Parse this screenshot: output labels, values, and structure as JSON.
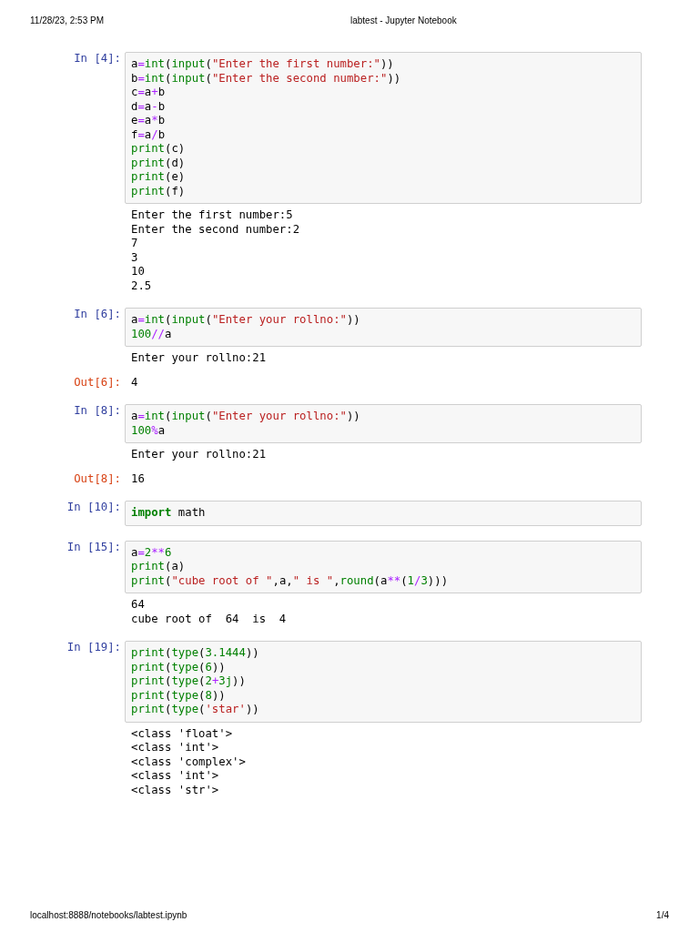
{
  "header": {
    "timestamp": "11/28/23, 2:53 PM",
    "title": "labtest - Jupyter Notebook"
  },
  "cells": [
    {
      "kind": "input",
      "prompt": "In [4]:",
      "lines": [
        [
          {
            "text": "a",
            "kind": "plain"
          },
          {
            "text": "=",
            "kind": "operator"
          },
          {
            "text": "int",
            "kind": "builtin"
          },
          {
            "text": "(",
            "kind": "plain"
          },
          {
            "text": "input",
            "kind": "builtin"
          },
          {
            "text": "(",
            "kind": "plain"
          },
          {
            "text": "\"Enter the first number:\"",
            "kind": "string"
          },
          {
            "text": "))",
            "kind": "plain"
          }
        ],
        [
          {
            "text": "b",
            "kind": "plain"
          },
          {
            "text": "=",
            "kind": "operator"
          },
          {
            "text": "int",
            "kind": "builtin"
          },
          {
            "text": "(",
            "kind": "plain"
          },
          {
            "text": "input",
            "kind": "builtin"
          },
          {
            "text": "(",
            "kind": "plain"
          },
          {
            "text": "\"Enter the second number:\"",
            "kind": "string"
          },
          {
            "text": "))",
            "kind": "plain"
          }
        ],
        [
          {
            "text": "c",
            "kind": "plain"
          },
          {
            "text": "=",
            "kind": "operator"
          },
          {
            "text": "a",
            "kind": "plain"
          },
          {
            "text": "+",
            "kind": "operator"
          },
          {
            "text": "b",
            "kind": "plain"
          }
        ],
        [
          {
            "text": "d",
            "kind": "plain"
          },
          {
            "text": "=",
            "kind": "operator"
          },
          {
            "text": "a",
            "kind": "plain"
          },
          {
            "text": "-",
            "kind": "operator"
          },
          {
            "text": "b",
            "kind": "plain"
          }
        ],
        [
          {
            "text": "e",
            "kind": "plain"
          },
          {
            "text": "=",
            "kind": "operator"
          },
          {
            "text": "a",
            "kind": "plain"
          },
          {
            "text": "*",
            "kind": "operator"
          },
          {
            "text": "b",
            "kind": "plain"
          }
        ],
        [
          {
            "text": "f",
            "kind": "plain"
          },
          {
            "text": "=",
            "kind": "operator"
          },
          {
            "text": "a",
            "kind": "plain"
          },
          {
            "text": "/",
            "kind": "operator"
          },
          {
            "text": "b",
            "kind": "plain"
          }
        ],
        [
          {
            "text": "print",
            "kind": "builtin"
          },
          {
            "text": "(c)",
            "kind": "plain"
          }
        ],
        [
          {
            "text": "print",
            "kind": "builtin"
          },
          {
            "text": "(d)",
            "kind": "plain"
          }
        ],
        [
          {
            "text": "print",
            "kind": "builtin"
          },
          {
            "text": "(e)",
            "kind": "plain"
          }
        ],
        [
          {
            "text": "print",
            "kind": "builtin"
          },
          {
            "text": "(f)",
            "kind": "plain"
          }
        ]
      ]
    },
    {
      "kind": "stream",
      "lines": [
        "Enter the first number:5",
        "Enter the second number:2",
        "7",
        "3",
        "10",
        "2.5"
      ]
    },
    {
      "kind": "input",
      "prompt": "In [6]:",
      "lines": [
        [
          {
            "text": "a",
            "kind": "plain"
          },
          {
            "text": "=",
            "kind": "operator"
          },
          {
            "text": "int",
            "kind": "builtin"
          },
          {
            "text": "(",
            "kind": "plain"
          },
          {
            "text": "input",
            "kind": "builtin"
          },
          {
            "text": "(",
            "kind": "plain"
          },
          {
            "text": "\"Enter your rollno:\"",
            "kind": "string"
          },
          {
            "text": "))",
            "kind": "plain"
          }
        ],
        [
          {
            "text": "100",
            "kind": "number"
          },
          {
            "text": "//",
            "kind": "operator"
          },
          {
            "text": "a",
            "kind": "plain"
          }
        ]
      ]
    },
    {
      "kind": "stream",
      "lines": [
        "Enter your rollno:21"
      ]
    },
    {
      "kind": "result",
      "prompt": "Out[6]:",
      "lines": [
        "4"
      ]
    },
    {
      "kind": "input",
      "prompt": "In [8]:",
      "lines": [
        [
          {
            "text": "a",
            "kind": "plain"
          },
          {
            "text": "=",
            "kind": "operator"
          },
          {
            "text": "int",
            "kind": "builtin"
          },
          {
            "text": "(",
            "kind": "plain"
          },
          {
            "text": "input",
            "kind": "builtin"
          },
          {
            "text": "(",
            "kind": "plain"
          },
          {
            "text": "\"Enter your rollno:\"",
            "kind": "string"
          },
          {
            "text": "))",
            "kind": "plain"
          }
        ],
        [
          {
            "text": "100",
            "kind": "number"
          },
          {
            "text": "%",
            "kind": "operator"
          },
          {
            "text": "a",
            "kind": "plain"
          }
        ]
      ]
    },
    {
      "kind": "stream",
      "lines": [
        "Enter your rollno:21"
      ]
    },
    {
      "kind": "result",
      "prompt": "Out[8]:",
      "lines": [
        "16"
      ]
    },
    {
      "kind": "input",
      "prompt": "In [10]:",
      "lines": [
        [
          {
            "text": "import",
            "kind": "keyword"
          },
          {
            "text": " math",
            "kind": "plain"
          }
        ]
      ]
    },
    {
      "kind": "input",
      "prompt": "In [15]:",
      "lines": [
        [
          {
            "text": "a",
            "kind": "plain"
          },
          {
            "text": "=",
            "kind": "operator"
          },
          {
            "text": "2",
            "kind": "number"
          },
          {
            "text": "**",
            "kind": "operator"
          },
          {
            "text": "6",
            "kind": "number"
          }
        ],
        [
          {
            "text": "print",
            "kind": "builtin"
          },
          {
            "text": "(a)",
            "kind": "plain"
          }
        ],
        [
          {
            "text": "print",
            "kind": "builtin"
          },
          {
            "text": "(",
            "kind": "plain"
          },
          {
            "text": "\"cube root of \"",
            "kind": "string"
          },
          {
            "text": ",a,",
            "kind": "plain"
          },
          {
            "text": "\" is \"",
            "kind": "string"
          },
          {
            "text": ",",
            "kind": "plain"
          },
          {
            "text": "round",
            "kind": "builtin"
          },
          {
            "text": "(a",
            "kind": "plain"
          },
          {
            "text": "**",
            "kind": "operator"
          },
          {
            "text": "(",
            "kind": "plain"
          },
          {
            "text": "1",
            "kind": "number"
          },
          {
            "text": "/",
            "kind": "operator"
          },
          {
            "text": "3",
            "kind": "number"
          },
          {
            "text": ")))",
            "kind": "plain"
          }
        ]
      ]
    },
    {
      "kind": "stream",
      "lines": [
        "64",
        "cube root of  64  is  4"
      ]
    },
    {
      "kind": "input",
      "prompt": "In [19]:",
      "lines": [
        [
          {
            "text": "print",
            "kind": "builtin"
          },
          {
            "text": "(",
            "kind": "plain"
          },
          {
            "text": "type",
            "kind": "builtin"
          },
          {
            "text": "(",
            "kind": "plain"
          },
          {
            "text": "3.1444",
            "kind": "number"
          },
          {
            "text": "))",
            "kind": "plain"
          }
        ],
        [
          {
            "text": "print",
            "kind": "builtin"
          },
          {
            "text": "(",
            "kind": "plain"
          },
          {
            "text": "type",
            "kind": "builtin"
          },
          {
            "text": "(",
            "kind": "plain"
          },
          {
            "text": "6",
            "kind": "number"
          },
          {
            "text": "))",
            "kind": "plain"
          }
        ],
        [
          {
            "text": "print",
            "kind": "builtin"
          },
          {
            "text": "(",
            "kind": "plain"
          },
          {
            "text": "type",
            "kind": "builtin"
          },
          {
            "text": "(",
            "kind": "plain"
          },
          {
            "text": "2",
            "kind": "number"
          },
          {
            "text": "+",
            "kind": "operator"
          },
          {
            "text": "3j",
            "kind": "number"
          },
          {
            "text": "))",
            "kind": "plain"
          }
        ],
        [
          {
            "text": "print",
            "kind": "builtin"
          },
          {
            "text": "(",
            "kind": "plain"
          },
          {
            "text": "type",
            "kind": "builtin"
          },
          {
            "text": "(",
            "kind": "plain"
          },
          {
            "text": "8",
            "kind": "number"
          },
          {
            "text": "))",
            "kind": "plain"
          }
        ],
        [
          {
            "text": "print",
            "kind": "builtin"
          },
          {
            "text": "(",
            "kind": "plain"
          },
          {
            "text": "type",
            "kind": "builtin"
          },
          {
            "text": "(",
            "kind": "plain"
          },
          {
            "text": "'star'",
            "kind": "string"
          },
          {
            "text": "))",
            "kind": "plain"
          }
        ]
      ]
    },
    {
      "kind": "stream",
      "lines": [
        "<class 'float'>",
        "<class 'int'>",
        "<class 'complex'>",
        "<class 'int'>",
        "<class 'str'>"
      ]
    }
  ],
  "footer": {
    "url": "localhost:8888/notebooks/labtest.ipynb",
    "page": "1/4"
  }
}
